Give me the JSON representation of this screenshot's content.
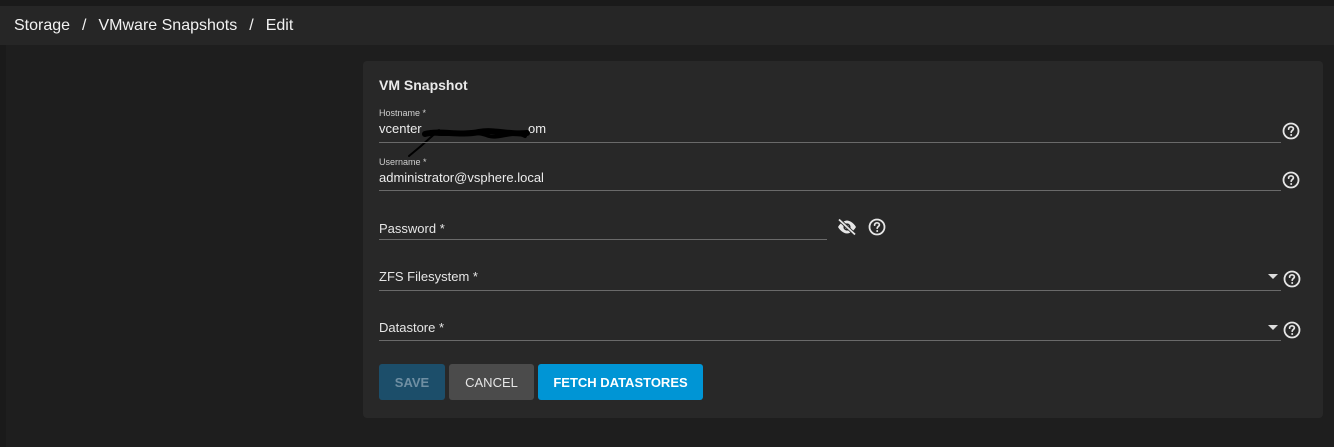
{
  "breadcrumb": {
    "items": [
      "Storage",
      "VMware Snapshots",
      "Edit"
    ],
    "separator": "/"
  },
  "form": {
    "title": "VM Snapshot",
    "hostname": {
      "label": "Hostname *",
      "value_prefix": "vcenter",
      "value_suffix": "om"
    },
    "username": {
      "label": "Username *",
      "value": "administrator@vsphere.local"
    },
    "password": {
      "label": "Password *"
    },
    "zfs_filesystem": {
      "label": "ZFS Filesystem *"
    },
    "datastore": {
      "label": "Datastore *"
    }
  },
  "buttons": {
    "save": "SAVE",
    "cancel": "CANCEL",
    "fetch": "FETCH DATASTORES"
  },
  "icons": {
    "help": "help-circle-icon",
    "visibility": "visibility-off-icon",
    "dropdown": "dropdown-arrow-icon"
  },
  "colors": {
    "accent": "#0095d5",
    "save_disabled": "#1c4e6a",
    "card_bg": "#282828",
    "page_bg": "#1e1e1e"
  }
}
